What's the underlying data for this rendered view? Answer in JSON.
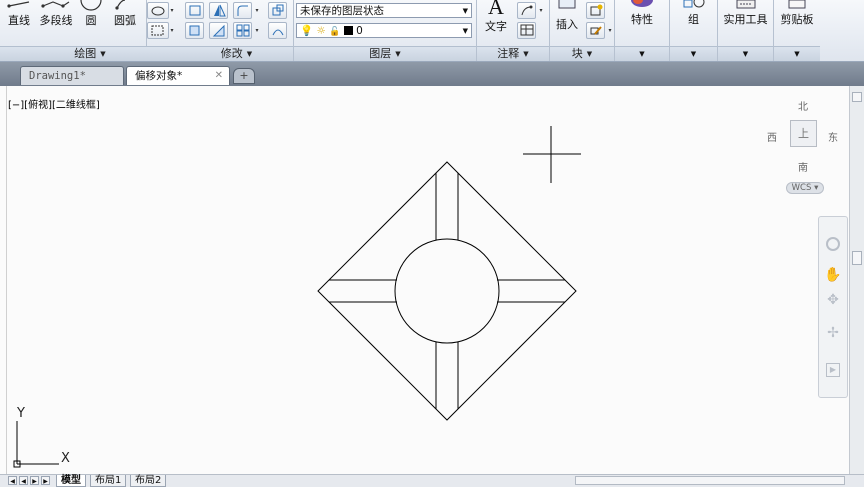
{
  "ribbon": {
    "draw_panel": {
      "title": "绘图",
      "buttons": [
        {
          "label": "直线",
          "icon": "line-icon"
        },
        {
          "label": "多段线",
          "icon": "polyline-icon"
        },
        {
          "label": "圆",
          "icon": "circle-icon"
        },
        {
          "label": "圆弧",
          "icon": "arc-icon"
        }
      ]
    },
    "modify_panel": {
      "title": "修改"
    },
    "layers_panel": {
      "title": "图层",
      "layer_state": "未保存的图层状态",
      "current_layer": "0"
    },
    "annotation_panel": {
      "title": "注释",
      "text_label": "文字"
    },
    "block_panel": {
      "title": "块",
      "insert_label": "插入"
    },
    "properties_label": "特性",
    "group_label": "组",
    "utilities_label": "实用工具",
    "clipboard_label": "剪贴板"
  },
  "tabs": [
    {
      "label": "Drawing1*",
      "active": false
    },
    {
      "label": "偏移对象*",
      "active": true
    }
  ],
  "viewport": {
    "label": "[−][俯视][二维线框]",
    "compass": {
      "north": "北",
      "south": "南",
      "east": "东",
      "west": "西",
      "top": "上"
    },
    "wcs": "WCS",
    "ucs_x": "X",
    "ucs_y": "Y"
  },
  "layout_tabs": [
    "模型",
    "布局1",
    "布局2"
  ],
  "colors": {
    "ribbon_bg": "#e3e9f1",
    "tabbar_bg": "#7e8998",
    "active_tab": "#ffffff",
    "inactive_tab": "#d8dde4",
    "canvas_bg": "#fbfbfb",
    "stroke": "#000000"
  }
}
